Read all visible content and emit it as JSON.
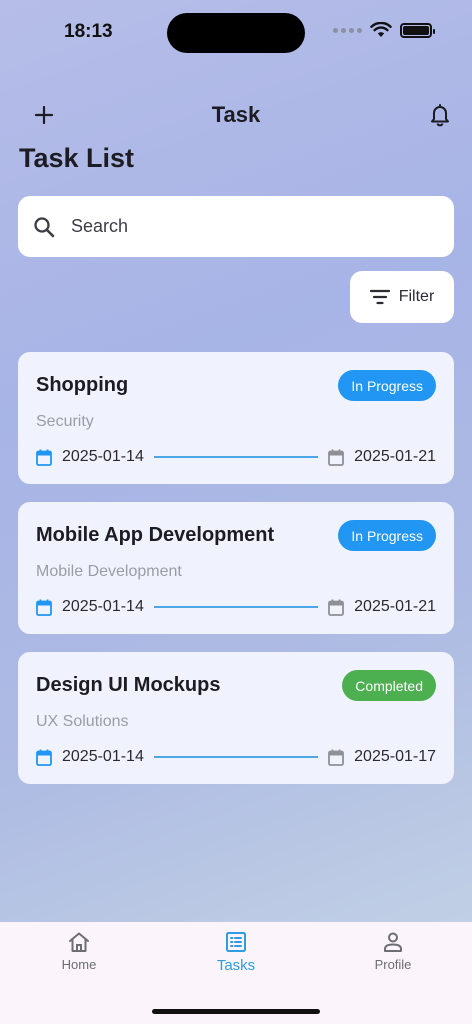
{
  "status_bar": {
    "time": "18:13"
  },
  "app_bar": {
    "title": "Task"
  },
  "page": {
    "title": "Task List"
  },
  "search": {
    "placeholder": "Search"
  },
  "filter": {
    "label": "Filter"
  },
  "colors": {
    "in_progress": "#2196f3",
    "completed": "#4caf50",
    "accent": "#2f9be0",
    "date_line": "#4ca7e3"
  },
  "tasks": [
    {
      "title": "Shopping",
      "status": "In Progress",
      "category": "Security",
      "start": "2025-01-14",
      "end": "2025-01-21"
    },
    {
      "title": "Mobile App Development",
      "status": "In Progress",
      "category": "Mobile Development",
      "start": "2025-01-14",
      "end": "2025-01-21"
    },
    {
      "title": "Design UI Mockups",
      "status": "Completed",
      "category": "UX Solutions",
      "start": "2025-01-14",
      "end": "2025-01-17"
    }
  ],
  "nav": {
    "items": [
      {
        "label": "Home",
        "icon": "home-icon"
      },
      {
        "label": "Tasks",
        "icon": "list-icon",
        "active": true
      },
      {
        "label": "Profile",
        "icon": "person-icon"
      }
    ]
  }
}
